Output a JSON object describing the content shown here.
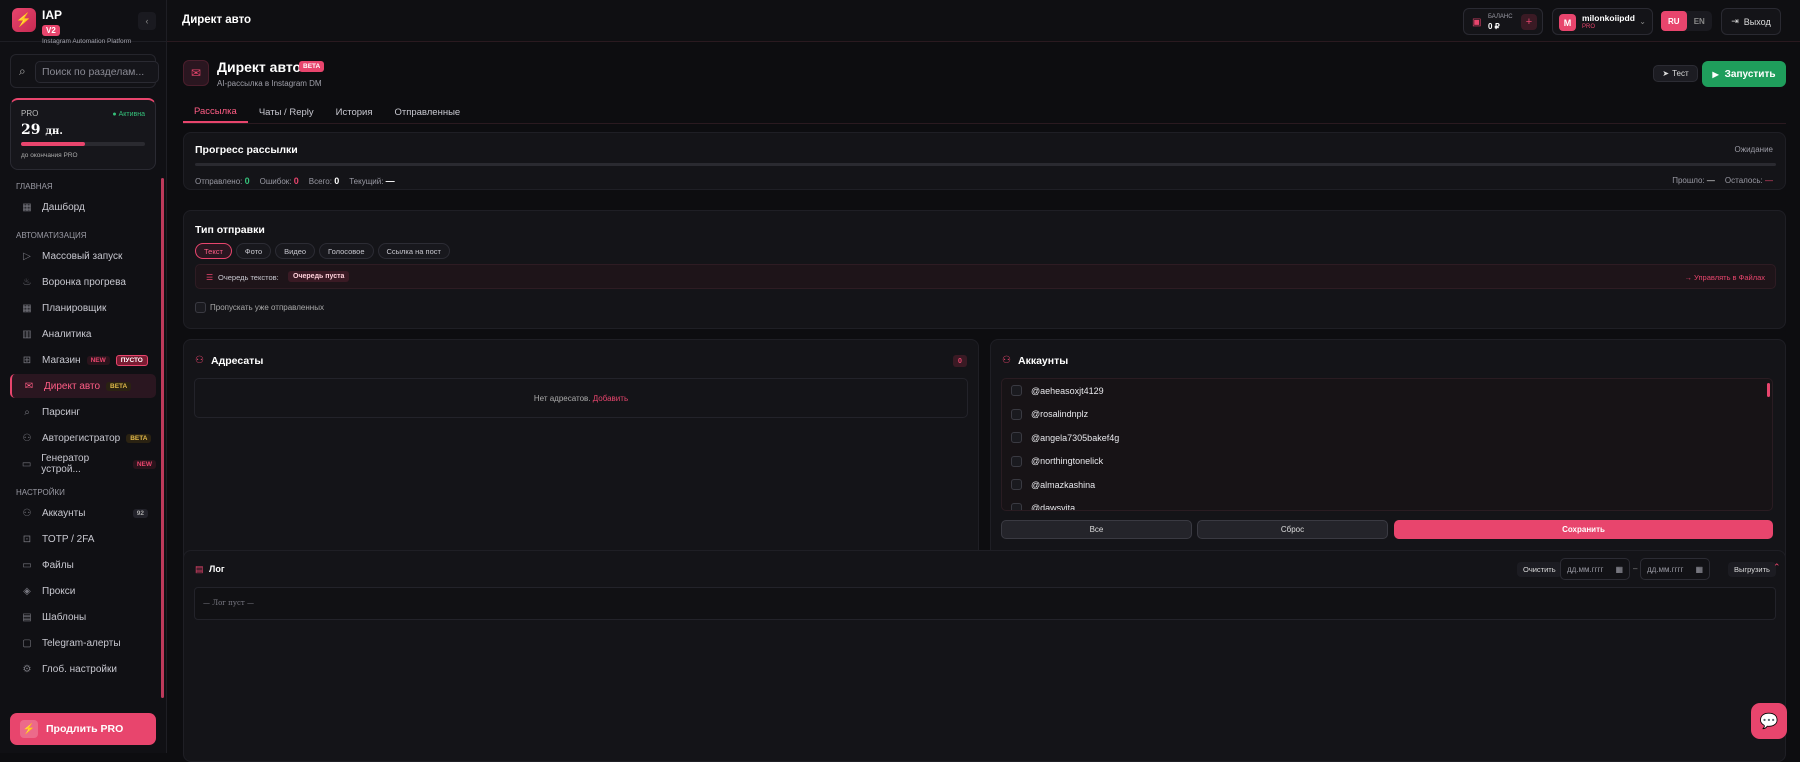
{
  "brand": {
    "logo": "⚡",
    "name": "IAP",
    "version": "V2",
    "subtitle": "Instagram Automation Platform",
    "collapse_icon": "‹"
  },
  "search": {
    "placeholder": "Поиск по разделам..."
  },
  "plan": {
    "label": "PRO",
    "status": "● Активна",
    "days": "29",
    "days_unit": "дн.",
    "progress_fraction": 0.52,
    "note": "до окончания PRO"
  },
  "nav": {
    "sections": [
      {
        "title": "Главная",
        "items": [
          {
            "label": "Дашборд",
            "icon": "grid-icon"
          }
        ]
      },
      {
        "title": "Автоматизация",
        "items": [
          {
            "label": "Массовый запуск",
            "icon": "play-icon"
          },
          {
            "label": "Воронка прогрева",
            "icon": "flame-icon"
          },
          {
            "label": "Планировщик",
            "icon": "calendar-icon"
          },
          {
            "label": "Аналитика",
            "icon": "bar-chart-icon"
          },
          {
            "label": "Магазин",
            "icon": "cart-icon",
            "tags": [
              "NEW",
              "ПУСТО"
            ]
          },
          {
            "label": "Директ авто",
            "icon": "mail-icon",
            "tags": [
              "BETA"
            ],
            "active": true
          },
          {
            "label": "Парсинг",
            "icon": "search-icon"
          },
          {
            "label": "Авторегистратор",
            "icon": "user-plus-icon",
            "tags": [
              "BETA"
            ]
          },
          {
            "label": "Генератор устрой...",
            "icon": "device-icon",
            "tags": [
              "NEW"
            ]
          }
        ]
      },
      {
        "title": "Настройки",
        "items": [
          {
            "label": "Аккаунты",
            "icon": "users-icon",
            "count": "92"
          },
          {
            "label": "TOTP / 2FA",
            "icon": "lock-icon"
          },
          {
            "label": "Файлы",
            "icon": "folder-icon"
          },
          {
            "label": "Прокси",
            "icon": "layers-icon"
          },
          {
            "label": "Шаблоны",
            "icon": "template-icon"
          },
          {
            "label": "Telegram-алерты",
            "icon": "chat-icon"
          },
          {
            "label": "Глоб. настройки",
            "icon": "gear-icon"
          }
        ]
      }
    ]
  },
  "cta": {
    "label": "Продлить PRO"
  },
  "topbar": {
    "title": "Директ авто",
    "balance_label": "БАЛАНС",
    "balance_value": "0 ₽",
    "user_initial": "M",
    "user_name": "milonkoiipdd",
    "user_role": "PRO",
    "lang_ru": "RU",
    "lang_en": "EN",
    "logout": "Выход"
  },
  "header": {
    "title": "Директ авто",
    "badge": "BETA",
    "subtitle": "AI-рассылка в Instagram DM",
    "test_button": "Тест",
    "run_button": "Запустить"
  },
  "tabs": [
    "Рассылка",
    "Чаты / Reply",
    "История",
    "Отправленные"
  ],
  "progress": {
    "title": "Прогресс рассылки",
    "status": "Ожидание",
    "sent_label": "Отправлено:",
    "sent": "0",
    "errors_label": "Ошибок:",
    "errors": "0",
    "total_label": "Всего:",
    "total": "0",
    "current_label": "Текущий:",
    "current": "—",
    "elapsed_label": "Прошло:",
    "elapsed": "—",
    "left_label": "Осталось:",
    "left": "—"
  },
  "send_type": {
    "title": "Тип отправки",
    "options": [
      "Текст",
      "Фото",
      "Видео",
      "Голосовое",
      "Ссылка на пост"
    ],
    "selected": "Текст",
    "queue_label": "Очередь текстов:",
    "queue_badge": "Очередь пуста",
    "queue_link": "→ Управлять в Файлах",
    "skip_label": "Пропускать уже отправленных"
  },
  "recipients": {
    "title": "Адресаты",
    "count": "0",
    "empty": "Нет адресатов.",
    "add_link": "Добавить"
  },
  "accounts": {
    "title": "Аккаунты",
    "items": [
      "@aeheasoxjt4129",
      "@rosalindnplz",
      "@angela7305bakef4g",
      "@northingtonelick",
      "@almazkashina",
      "@dawsvita"
    ],
    "all_button": "Все",
    "reset_button": "Сброс",
    "save_button": "Сохранить"
  },
  "log": {
    "title": "Лог",
    "clear": "Очистить",
    "date_placeholder": "дд.мм.гггг",
    "date_sep": "–",
    "export": "Выгрузить",
    "empty": "— Лог пуст —"
  },
  "colors": {
    "accent": "#e8456d",
    "success": "#1f9e5c"
  }
}
